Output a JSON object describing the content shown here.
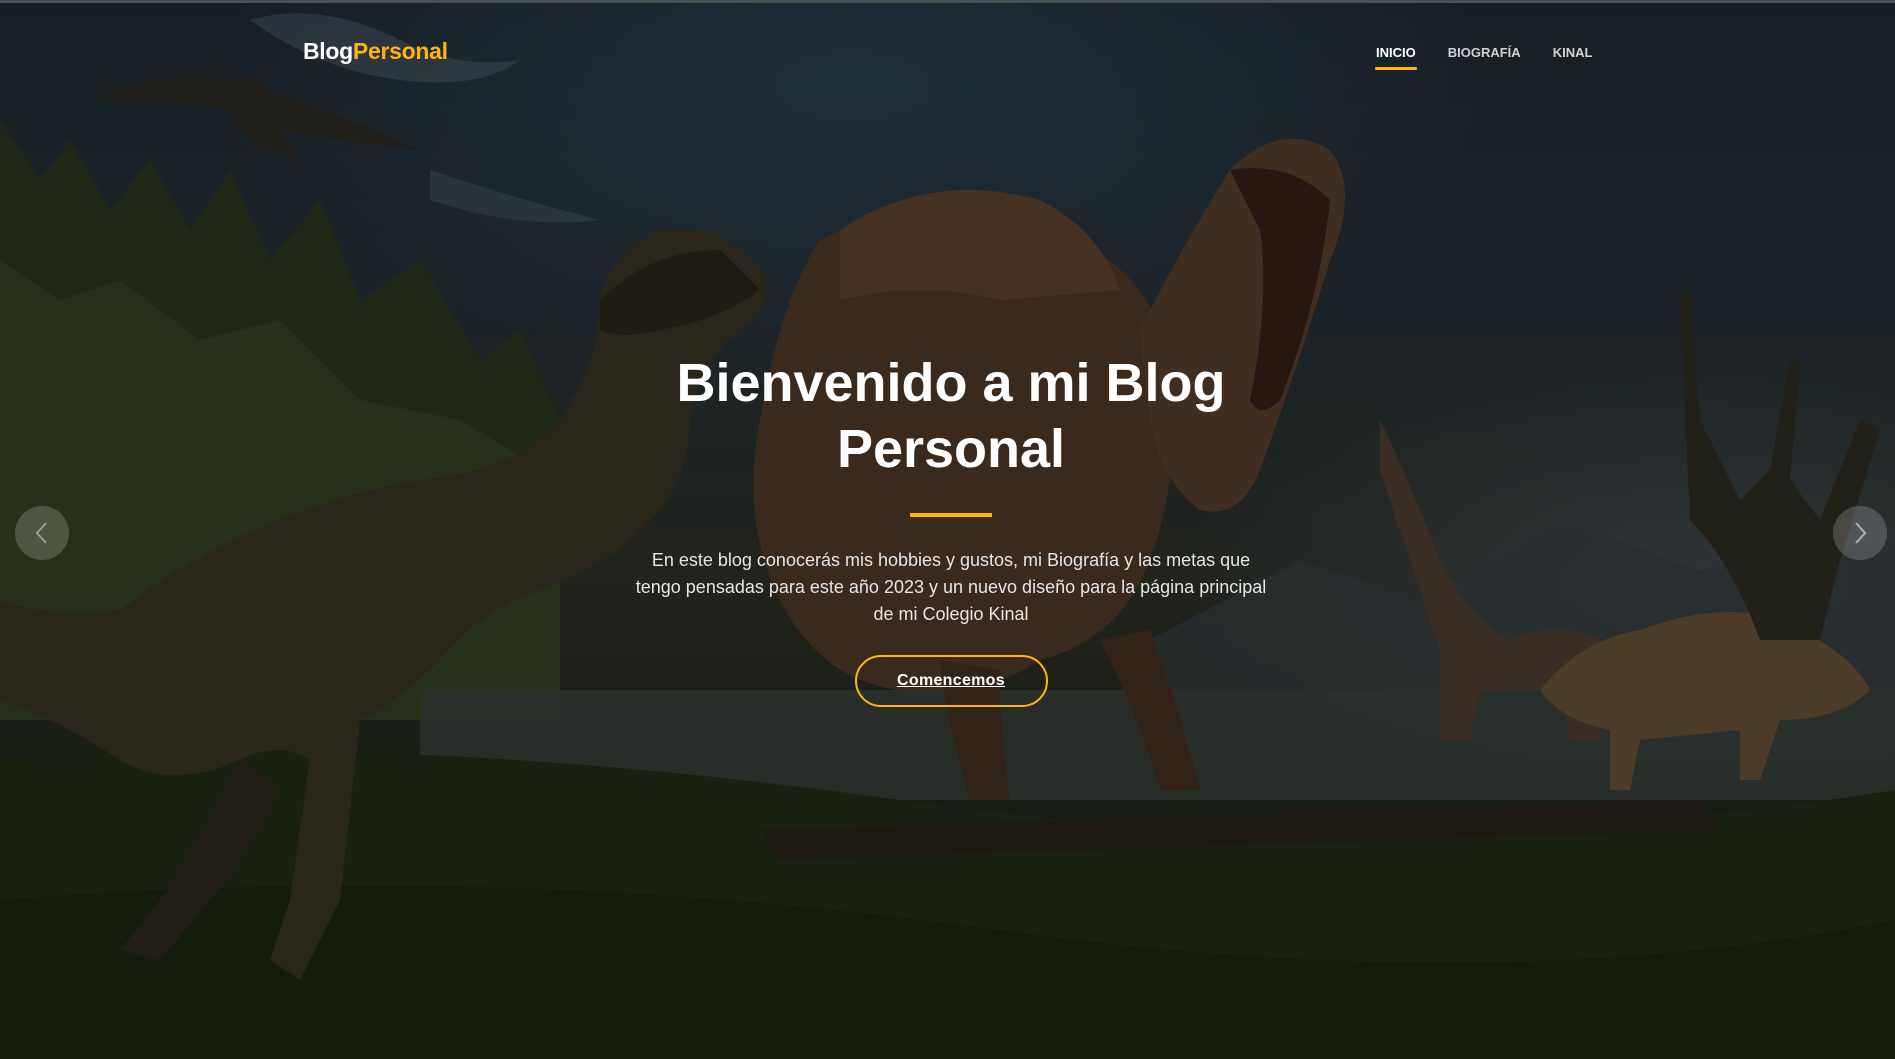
{
  "header": {
    "logo_part1": "Blog",
    "logo_part2": "Personal"
  },
  "nav": {
    "items": [
      {
        "label": "INICIO",
        "active": true
      },
      {
        "label": "BIOGRAFÍA",
        "active": false
      },
      {
        "label": "KINAL",
        "active": false
      }
    ]
  },
  "hero": {
    "title": "Bienvenido a mi Blog Personal",
    "description": "En este blog conocerás mis hobbies y gustos, mi Biografía y las metas que tengo pensadas para este año 2023 y un nuevo diseño para la página principal de mi Colegio Kinal",
    "cta_label": "Comencemos",
    "background_image": "dinosaur-scene"
  },
  "carousel": {
    "prev_icon": "chevron-left-icon",
    "next_icon": "chevron-right-icon"
  },
  "colors": {
    "accent": "#ffb40f",
    "text": "#ffffff"
  }
}
